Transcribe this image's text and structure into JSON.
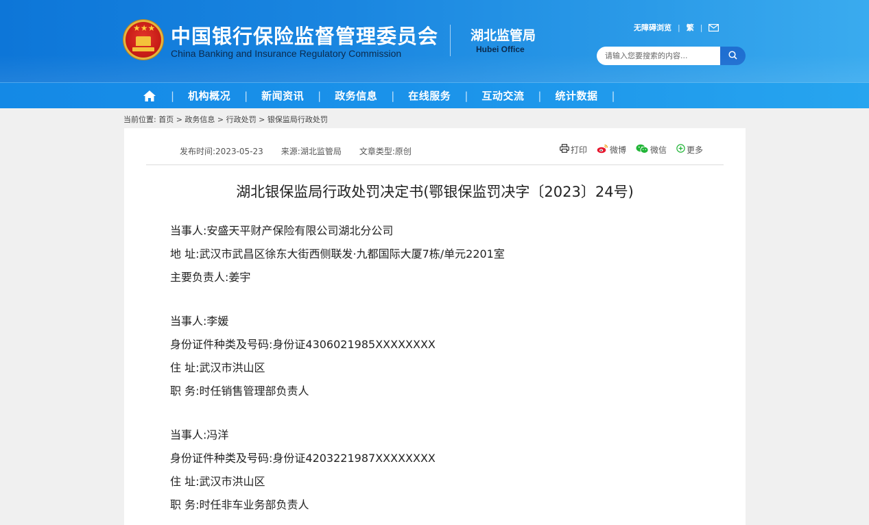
{
  "header": {
    "org_name_cn": "中国银行保险监督管理委员会",
    "org_name_en": "China Banking and Insurance Regulatory Commission",
    "office_cn": "湖北监管局",
    "office_en": "Hubei Office",
    "links": {
      "accessibility": "无障碍浏览",
      "traditional": "繁"
    },
    "search": {
      "placeholder": "请输入您要搜索的内容..."
    }
  },
  "nav": {
    "items": [
      "机构概况",
      "新闻资讯",
      "政务信息",
      "在线服务",
      "互动交流",
      "统计数据"
    ]
  },
  "breadcrumb": {
    "text": "当前位置:  首页 > 政务信息 > 行政处罚 > 银保监局行政处罚"
  },
  "article": {
    "meta": {
      "date": "发布时间:2023-05-23",
      "source": "来源:湖北监管局",
      "type": "文章类型:原创"
    },
    "share": {
      "print": "打印",
      "weibo": "微博",
      "wechat": "微信",
      "more": "更多"
    },
    "title": "湖北银保监局行政处罚决定书(鄂银保监罚决字〔2023〕24号)",
    "lines": [
      "当事人:安盛天平财产保险有限公司湖北分公司",
      "地  址:武汉市武昌区徐东大街西侧联发·九都国际大厦7栋/单元2201室",
      "主要负责人:姜宇",
      "当事人:李媛",
      "身份证件种类及号码:身份证4306021985XXXXXXXX",
      "住  址:武汉市洪山区",
      "职  务:时任销售管理部负责人",
      "当事人:冯洋",
      "身份证件种类及号码:身份证4203221987XXXXXXXX",
      "住  址:武汉市洪山区",
      "职  务:时任非车业务部负责人"
    ]
  },
  "colors": {
    "header_blue": "#0d76d8",
    "nav_blue": "#1b93ea",
    "search_button": "#1f6fd1",
    "emblem_red": "#c81e17"
  },
  "icons": [
    "national-emblem-icon",
    "mail-icon",
    "search-icon",
    "home-icon",
    "print-icon",
    "weibo-icon",
    "wechat-icon",
    "more-icon"
  ]
}
